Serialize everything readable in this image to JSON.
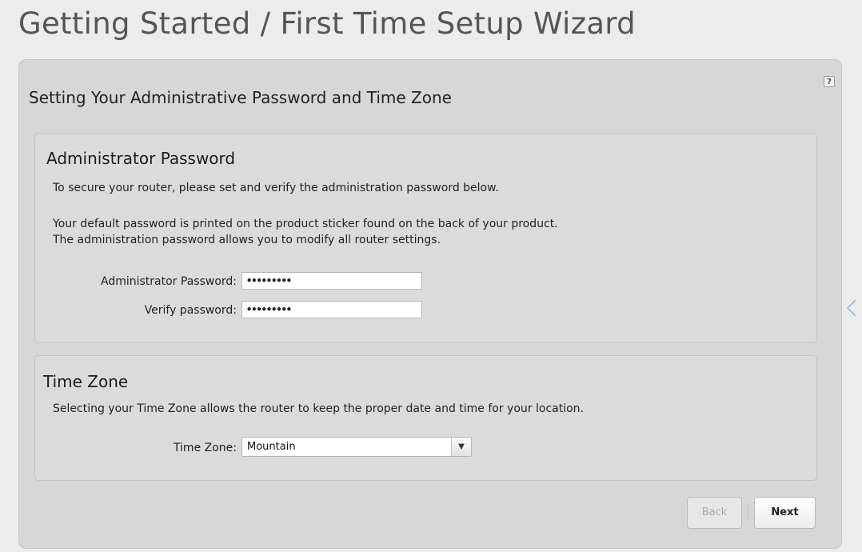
{
  "page": {
    "title": "Getting Started / First Time Setup Wizard"
  },
  "panel": {
    "title": "Setting Your Administrative Password and Time Zone",
    "help_label": "?"
  },
  "admin_password": {
    "title": "Administrator Password",
    "intro": "To secure your router, please set and verify the administration password below.",
    "note_line1": "Your default password is printed on the product sticker found on the back of your product.",
    "note_line2": "The administration password allows you to modify all router settings.",
    "password_label": "Administrator Password:",
    "password_value": "•••••••••",
    "verify_label": "Verify password:",
    "verify_value": "•••••••••"
  },
  "time_zone": {
    "title": "Time Zone",
    "intro": "Selecting your Time Zone allows the router to keep the proper date and time for your location.",
    "label": "Time Zone:",
    "selected": "Mountain"
  },
  "nav": {
    "back_label": "Back",
    "next_label": "Next"
  }
}
